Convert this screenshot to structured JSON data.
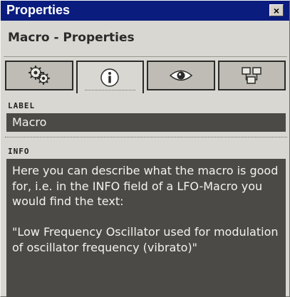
{
  "window": {
    "title": "Properties",
    "close_glyph": "×"
  },
  "panel": {
    "title": "Macro - Properties"
  },
  "tabs": [
    {
      "icon": "gears-icon",
      "active": false
    },
    {
      "icon": "info-icon",
      "active": true
    },
    {
      "icon": "eye-icon",
      "active": false
    },
    {
      "icon": "connections-icon",
      "active": false
    }
  ],
  "label_section": {
    "heading": "LABEL",
    "value": "Macro"
  },
  "info_section": {
    "heading": "INFO",
    "text": "Here you can describe what the macro is good for, i.e. in the INFO field of a LFO-Macro you would find the text:\n\n\"Low Frequency Oscillator used for modulation of oscillator frequency (vibrato)\""
  },
  "colors": {
    "titlebar": "#0a1c7e",
    "panel_bg": "#d8d7d1",
    "field_bg": "#4b4a46",
    "field_text": "#f2f2ee"
  }
}
